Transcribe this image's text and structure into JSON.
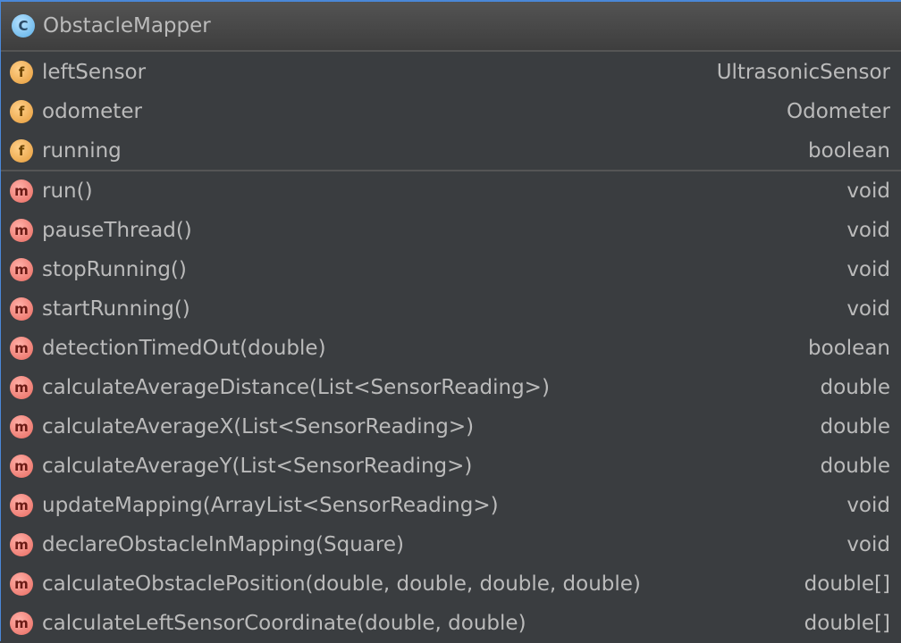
{
  "class": {
    "name": "ObstacleMapper",
    "icon": "class-icon"
  },
  "fields": [
    {
      "name": "leftSensor",
      "type": "UltrasonicSensor"
    },
    {
      "name": "odometer",
      "type": "Odometer"
    },
    {
      "name": "running",
      "type": "boolean"
    }
  ],
  "methods": [
    {
      "name": "run()",
      "type": "void"
    },
    {
      "name": "pauseThread()",
      "type": "void"
    },
    {
      "name": "stopRunning()",
      "type": "void"
    },
    {
      "name": "startRunning()",
      "type": "void"
    },
    {
      "name": "detectionTimedOut(double)",
      "type": "boolean"
    },
    {
      "name": "calculateAverageDistance(List<SensorReading>)",
      "type": "double"
    },
    {
      "name": "calculateAverageX(List<SensorReading>)",
      "type": "double"
    },
    {
      "name": "calculateAverageY(List<SensorReading>)",
      "type": "double"
    },
    {
      "name": "updateMapping(ArrayList<SensorReading>)",
      "type": "void"
    },
    {
      "name": "declareObstacleInMapping(Square)",
      "type": "void"
    },
    {
      "name": "calculateObstaclePosition(double, double, double, double)",
      "type": "double[]"
    },
    {
      "name": "calculateLeftSensorCoordinate(double, double)",
      "type": "double[]"
    }
  ],
  "icons": {
    "class": "C",
    "field": "f",
    "method": "m"
  }
}
